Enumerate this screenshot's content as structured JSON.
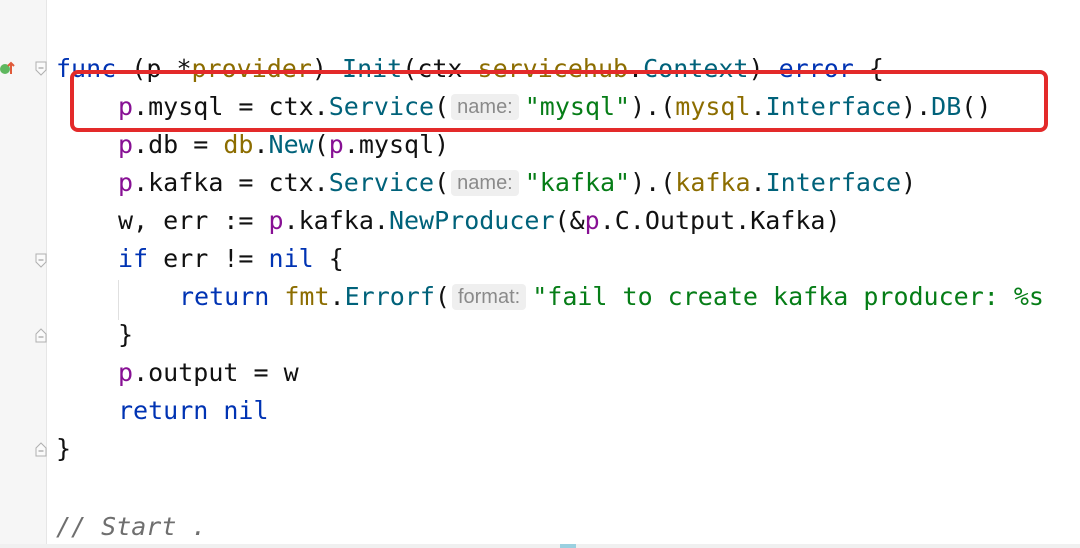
{
  "code": {
    "l1": {
      "kw1": "func",
      "open": " (",
      "recv": "p",
      "sp1": " *",
      "recvType": "provider",
      "close": ") ",
      "fname": "Init",
      "paren": "(",
      "param": "ctx",
      "sp2": " ",
      "pkg": "servicehub",
      "dot": ".",
      "ptype": "Context",
      "close2": ") ",
      "ret": "error",
      "brace": " {"
    },
    "l2": {
      "obj": "p",
      "field": ".mysql",
      "assign": " = ctx.",
      "fn": "Service",
      "paren": "(",
      "hint": "name:",
      "arg": "\"mysql\"",
      "mid": ").(",
      "pkg": "mysql",
      "dot": ".",
      "iface": "Interface",
      "close": ").",
      "method": "DB",
      "end": "()"
    },
    "l3": {
      "obj": "p",
      "field": ".db",
      "assign": " = ",
      "pkg": "db",
      "dot": ".",
      "fn": "New",
      "paren": "(",
      "arg": "p",
      "argField": ".mysql",
      "end": ")"
    },
    "l4": {
      "obj": "p",
      "field": ".kafka",
      "assign": " = ctx.",
      "fn": "Service",
      "paren": "(",
      "hint": "name:",
      "arg": "\"kafka\"",
      "mid": ").(",
      "pkg": "kafka",
      "dot": ".",
      "iface": "Interface",
      "end": ")"
    },
    "l5": {
      "lhs": "w, err := ",
      "obj": "p",
      "field": ".kafka.",
      "fn": "NewProducer",
      "paren": "(&",
      "arg": "p",
      "rest": ".C.Output.Kafka)"
    },
    "l6": {
      "kw": "if",
      "mid": " err != ",
      "nil": "nil",
      "brace": " {"
    },
    "l7": {
      "kw": "return",
      "sp": " ",
      "pkg": "fmt",
      "dot": ".",
      "fn": "Errorf",
      "paren": "(",
      "hint": "format:",
      "str": "\"fail to create kafka producer: %s"
    },
    "l8": {
      "brace": "}"
    },
    "l9": {
      "obj": "p",
      "field": ".output",
      "rest": " = w"
    },
    "l10": {
      "kw": "return",
      "sp": " ",
      "nil": "nil"
    },
    "l11": {
      "brace": "}"
    },
    "l12": {
      "comment": "// Start ."
    }
  },
  "colors": {
    "keyword": "#0033b3",
    "type": "#8c6d00",
    "function": "#00627a",
    "field": "#871094",
    "string": "#067d17",
    "highlight": "#e32a2a"
  },
  "icons": [
    "implementation-marker-icon",
    "fold-open-icon",
    "fold-close-icon"
  ]
}
